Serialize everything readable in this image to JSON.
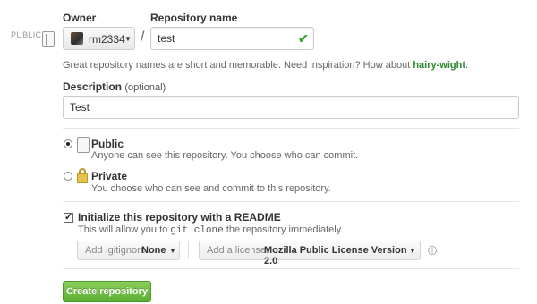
{
  "header": {
    "public_badge": "PUBLIC",
    "owner_label": "Owner",
    "repo_label": "Repository name",
    "slash": "/"
  },
  "owner": {
    "name": "rm2334"
  },
  "repo": {
    "value": "test"
  },
  "suggestion": {
    "text": "Great repository names are short and memorable. Need inspiration? How about ",
    "name": "hairy-wight",
    "end": "."
  },
  "description": {
    "label": "Description",
    "optional": "(optional)",
    "value": "Test"
  },
  "visibility": {
    "public": {
      "title": "Public",
      "desc": "Anyone can see this repository. You choose who can commit."
    },
    "private": {
      "title": "Private",
      "desc": "You choose who can see and commit to this repository."
    }
  },
  "init": {
    "label": "Initialize this repository with a README",
    "desc_pre": "This will allow you to",
    "desc_code": "git clone",
    "desc_post": "the repository immediately."
  },
  "gitignore": {
    "prefix": "Add .gitignore:",
    "value": "None"
  },
  "license": {
    "prefix": "Add a license:",
    "value": "Mozilla Public License Version 2.0"
  },
  "create_button": "Create repository",
  "icons": {
    "public_repo": "book-icon",
    "repo_public": "book-icon",
    "repo_private": "lock-icon",
    "valid": "check-icon",
    "dropdown": "caret-down-icon",
    "info": "info-icon"
  },
  "colors": {
    "accent_green": "#5cae34",
    "valid_check": "#3ca33c",
    "suggestion_name": "#2a8a2a"
  }
}
